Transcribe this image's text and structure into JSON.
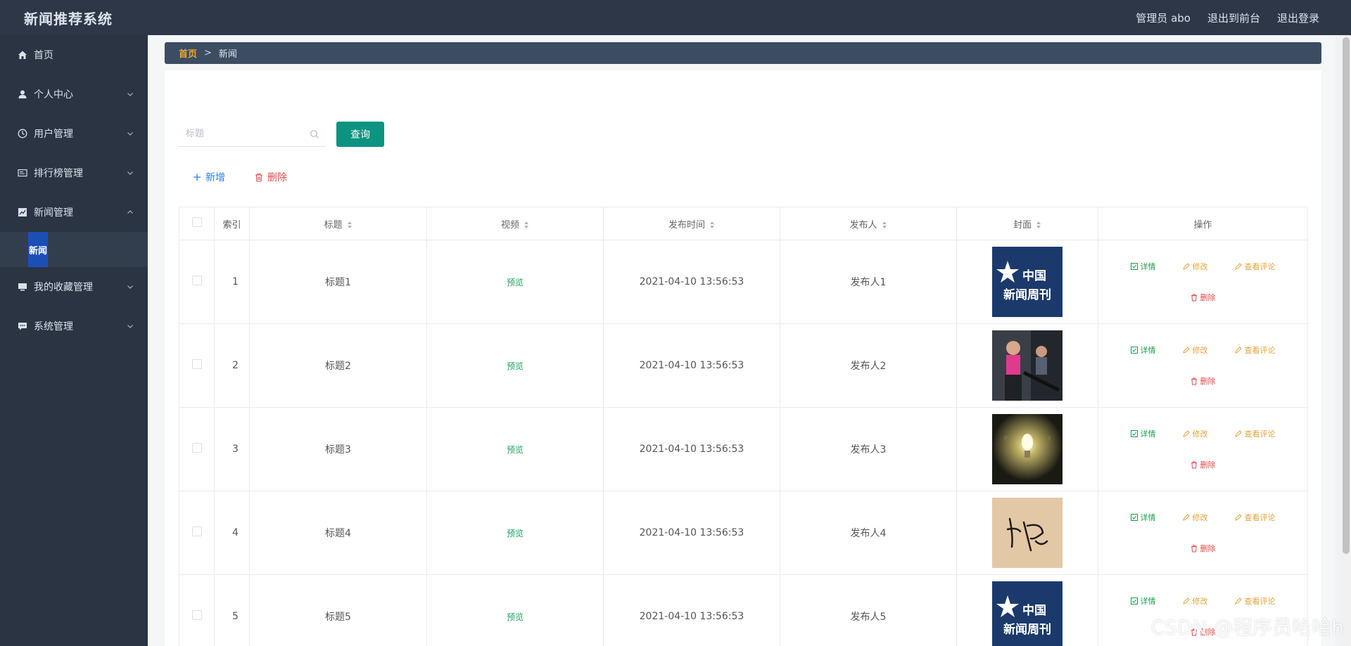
{
  "app": {
    "title": "新闻推荐系统"
  },
  "header": {
    "user": "管理员 abo",
    "to_frontend": "退出到前台",
    "logout": "退出登录"
  },
  "sidebar": {
    "items": [
      {
        "label": "首页",
        "icon": "home-icon"
      },
      {
        "label": "个人中心",
        "icon": "user-icon"
      },
      {
        "label": "用户管理",
        "icon": "clock-icon"
      },
      {
        "label": "排行榜管理",
        "icon": "list-card-icon"
      },
      {
        "label": "新闻管理",
        "icon": "chart-icon"
      },
      {
        "label": "我的收藏管理",
        "icon": "monitor-icon"
      },
      {
        "label": "系统管理",
        "icon": "chat-icon"
      }
    ],
    "active_sub": "新闻"
  },
  "breadcrumb": {
    "home": "首页",
    "separator": ">",
    "current": "新闻"
  },
  "search": {
    "placeholder": "标题",
    "button": "查询"
  },
  "actions": {
    "add": "新增",
    "delete": "删除"
  },
  "table": {
    "headers": {
      "index": "索引",
      "title": "标题",
      "video": "视频",
      "time": "发布时间",
      "publisher": "发布人",
      "cover": "封面",
      "ops": "操作"
    },
    "rows": [
      {
        "index": "1",
        "title": "标题1",
        "video": "预览",
        "time": "2021-04-10 13:56:53",
        "publisher": "发布人1",
        "cover": "news-weekly-logo"
      },
      {
        "index": "2",
        "title": "标题2",
        "video": "预览",
        "time": "2021-04-10 13:56:53",
        "publisher": "发布人2",
        "cover": "gym-photo"
      },
      {
        "index": "3",
        "title": "标题3",
        "video": "预览",
        "time": "2021-04-10 13:56:53",
        "publisher": "发布人3",
        "cover": "bulb-photo"
      },
      {
        "index": "4",
        "title": "标题4",
        "video": "预览",
        "time": "2021-04-10 13:56:53",
        "publisher": "发布人4",
        "cover": "calligraphy-photo"
      },
      {
        "index": "5",
        "title": "标题5",
        "video": "预览",
        "time": "2021-04-10 13:56:53",
        "publisher": "发布人5",
        "cover": "news-weekly-logo"
      }
    ],
    "ops": {
      "detail": "详情",
      "edit": "修改",
      "comment": "查看评论",
      "delete": "删除"
    },
    "logo_text": {
      "line1": "中国",
      "line2": "新闻周刊"
    }
  },
  "watermark": "CSDN @程序员哈哈h",
  "colors": {
    "topbar": "#2d3748",
    "sidebar": "#2b3442",
    "accent": "#0d9480",
    "active": "#1c4fb5"
  }
}
